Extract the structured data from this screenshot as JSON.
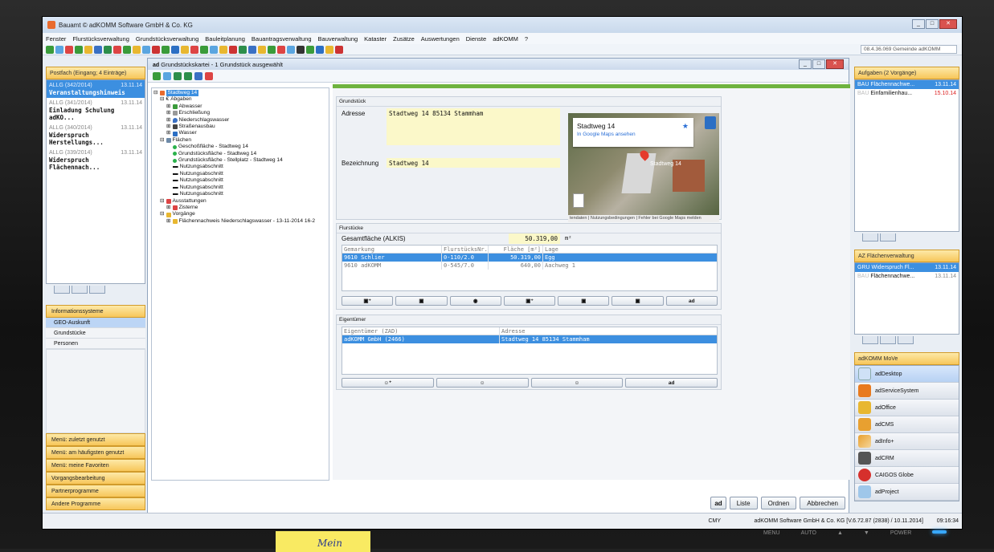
{
  "app": {
    "title": "Bauamt © adKOMM Software GmbH & Co. KG",
    "menu": [
      "Fenster",
      "Flurstücksverwaltung",
      "Grundstücksverwaltung",
      "Bauleitplanung",
      "Bauantragsverwaltung",
      "Bauverwaltung",
      "Kataster",
      "Zusätze",
      "Auswertungen",
      "Dienste",
      "adKOMM",
      "?"
    ],
    "location_select": "08.4.36.069 Gemeinde adKOMM"
  },
  "postfach": {
    "header": "Postfach (Eingang; 4 Einträge)",
    "items": [
      {
        "id": "ALLG (342/2014)",
        "date": "13.11.14",
        "title": "Veranstaltungshinweis"
      },
      {
        "id": "ALLG (341/2014)",
        "date": "13.11.14",
        "title": "Einladung Schulung adKO..."
      },
      {
        "id": "ALLG (340/2014)",
        "date": "13.11.14",
        "title": "Widerspruch Herstellungs..."
      },
      {
        "id": "ALLG (339/2014)",
        "date": "13.11.14",
        "title": "Widerspruch Flächennach..."
      }
    ]
  },
  "nav": {
    "info_header": "Informationssysteme",
    "info_items": [
      "GEO-Auskunft",
      "Grundstücke",
      "Personen"
    ],
    "bottom": [
      "Menü: zuletzt genutzt",
      "Menü: am häufigsten genutzt",
      "Menü: meine Favoriten",
      "Vorgangsbearbeitung",
      "Partnerprogramme",
      "Andere Programme"
    ]
  },
  "main": {
    "title": "Grundstückskartei - 1 Grundstück ausgewählt",
    "tree": {
      "root": "Stadtweg 14",
      "abgaben": "Abgaben",
      "abgaben_items": [
        "Abwasser",
        "Erschließung",
        "Niederschlagswasser",
        "Straßenausbau",
        "Wasser"
      ],
      "flaechen": "Flächen",
      "flaechen_items": [
        "Geschoßfläche - Stadtweg 14",
        "Grundstücksfläche - Stadtweg 14",
        "Grundstücksfläche - Stellplatz - Stadtweg 14"
      ],
      "nutzung": [
        "Nutzungsabschnitt",
        "Nutzungsabschnitt",
        "Nutzungsabschnitt",
        "Nutzungsabschnitt",
        "Nutzungsabschnitt"
      ],
      "ausstattungen": "Ausstattungen",
      "zisterne": "Zisterne",
      "vorgaenge": "Vorgänge",
      "vorgang_item": "Flächennachweis Niederschlagswasser - 13-11-2014 16-2"
    },
    "grundstueck": {
      "title": "Grundstück",
      "adresse_label": "Adresse",
      "adresse": "Stadtweg 14 85134 Stammham",
      "bezeichnung_label": "Bezeichnung",
      "bezeichnung": "Stadtweg 14",
      "map_title": "Stadtweg 14",
      "map_link": "In Google Maps ansehen",
      "map_pin": "Stadtweg 14",
      "map_footer": "tendaten | Nutzungsbedingungen | Fehler bei Google Maps melden"
    },
    "flurstuecke": {
      "title": "Flurstücke",
      "gesamt_label": "Gesamtfläche (ALKIS)",
      "gesamt_value": "50.319,00",
      "gesamt_unit": "m²",
      "columns": [
        "Gemarkung",
        "FlurstücksNr.",
        "Fläche [m²]",
        "Lage"
      ],
      "rows": [
        [
          "9610 Schlier",
          "0-110/2.0",
          "50.319,00",
          "Egg"
        ],
        [
          "9610 adKOMM",
          "0-545/7.0",
          "640,00",
          "Aachweg 1"
        ]
      ]
    },
    "eigentuemer": {
      "title": "Eigentümer",
      "columns": [
        "Eigentümer (ZAD)",
        "Adresse"
      ],
      "rows": [
        [
          "adKOMM GmbH (2466)",
          "Stadtweg 14 85134 Stammham"
        ]
      ]
    },
    "buttons": {
      "liste": "Liste",
      "ordnen": "Ordnen",
      "abbrechen": "Abbrechen",
      "ad": "ad"
    }
  },
  "aufgaben": {
    "header": "Aufgaben (2 Vorgänge)",
    "items": [
      {
        "pre": "BAU",
        "text": "Flächennachwe...",
        "date": "13.11.14"
      },
      {
        "pre": "BAU",
        "text": "Einfamilienhau...",
        "date": "15.10.14"
      }
    ]
  },
  "az": {
    "header": "AZ Flächenverwaltung",
    "items": [
      {
        "pre": "GRU",
        "text": "Widerspruch Fl...",
        "date": "13.11.14"
      },
      {
        "pre": "BAU",
        "text": "Flächennachwe...",
        "date": "13.11.14"
      }
    ]
  },
  "move": {
    "header": "adKOMM MoVe",
    "items": [
      "adDesktop",
      "adServiceSystem",
      "adOffice",
      "adCMS",
      "adInfo+",
      "adCRM",
      "CAIGOS Globe",
      "adProject"
    ]
  },
  "status": {
    "cmy": "CMY",
    "copyright": "adKOMM Software GmbH & Co. KG [V.6.72.87 (2838) / 10.11.2014]",
    "time": "09:16:34"
  },
  "monitor": {
    "menu": "MENU",
    "auto": "AUTO",
    "up": "▲",
    "down": "▼",
    "power": "POWER"
  },
  "sticky": "Mein"
}
